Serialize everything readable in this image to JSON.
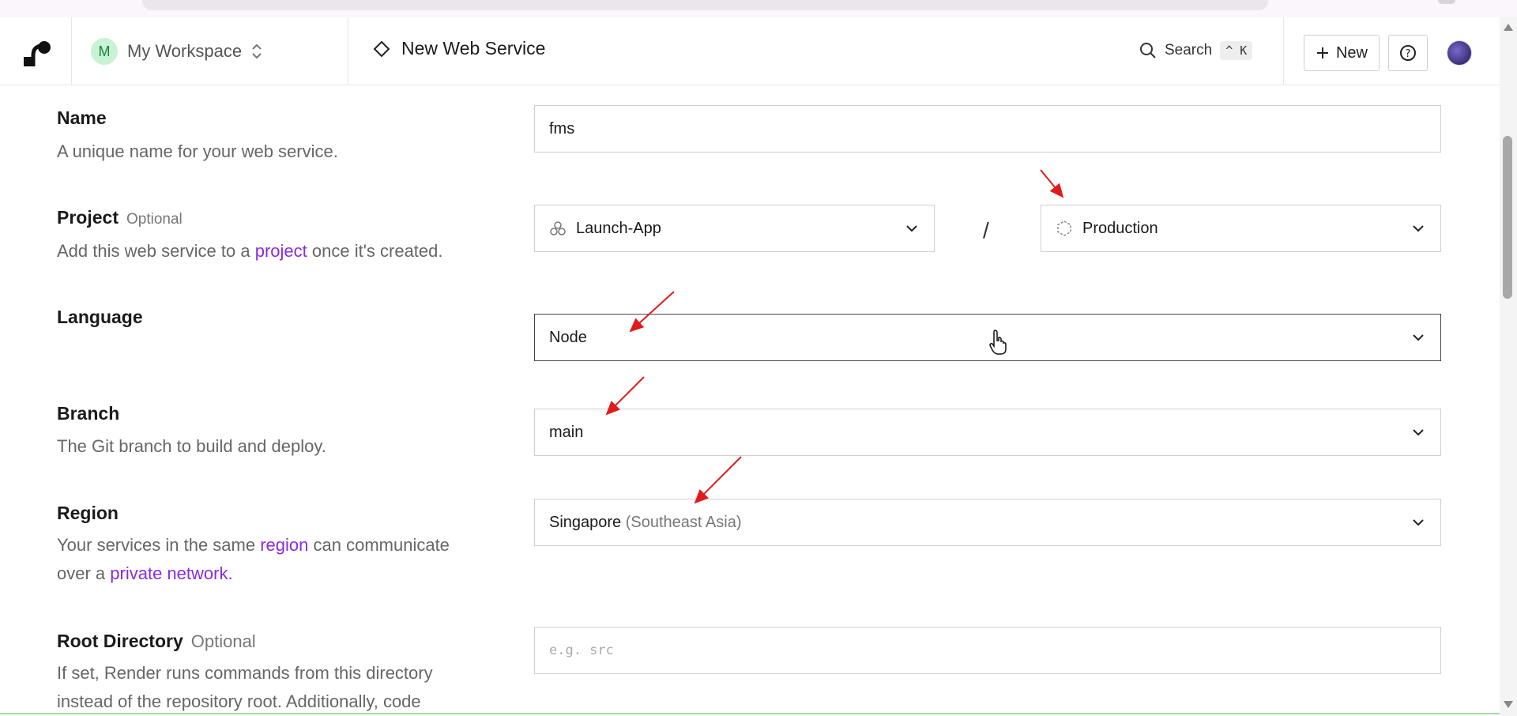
{
  "header": {
    "workspace_initial": "M",
    "workspace_name": "My Workspace",
    "page_title": "New Web Service",
    "search_label": "Search",
    "search_shortcut": "^ K",
    "new_button": "New"
  },
  "form": {
    "name": {
      "label": "Name",
      "description": "A unique name for your web service.",
      "value": "fms"
    },
    "project": {
      "label": "Project",
      "optional": "Optional",
      "description_prefix": "Add this web service to a",
      "description_link": "project",
      "description_suffix": "once it's created.",
      "project_value": "Launch-App",
      "separator": "/",
      "environment_value": "Production"
    },
    "language": {
      "label": "Language",
      "value": "Node"
    },
    "branch": {
      "label": "Branch",
      "description": "The Git branch to build and deploy.",
      "value": "main"
    },
    "region": {
      "label": "Region",
      "description_prefix": "Your services in the same",
      "description_link1": "region",
      "description_middle": "can communicate",
      "description_line2_prefix": "over a",
      "description_link2": "private network.",
      "value": "Singapore",
      "value_detail": "(Southeast Asia)"
    },
    "root_directory": {
      "label": "Root Directory",
      "optional": "Optional",
      "description_line1": "If set, Render runs commands from this directory",
      "description_line2": "instead of the repository root. Additionally, code",
      "placeholder": "e.g. src"
    }
  },
  "colors": {
    "link": "#8a2be2",
    "annotation_arrow": "#e01b1b",
    "workspace_avatar_bg": "#c7f2d4"
  },
  "icons": [
    "render-logo-icon",
    "chevron-updown-icon",
    "diamond-icon",
    "search-icon",
    "plus-icon",
    "help-circle-icon",
    "project-circles-icon",
    "environment-hexagon-icon",
    "chevron-down-icon",
    "hand-cursor-icon"
  ]
}
